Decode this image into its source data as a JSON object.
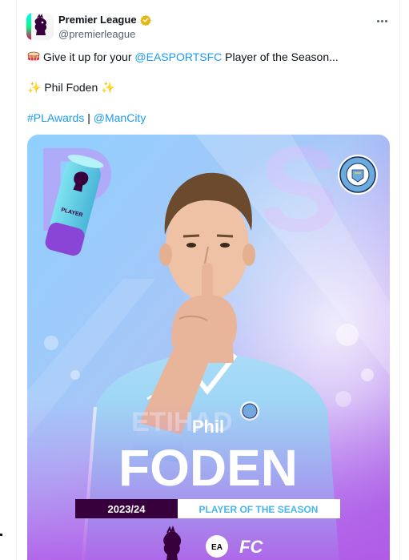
{
  "account": {
    "name": "Premier League",
    "handle": "@premierleague",
    "verified": true
  },
  "icons": {
    "avatar": "premier-league-lion-logo",
    "verified": "verified-badge-gold",
    "more": "more-horizontal-icon",
    "drum": "drum-emoji",
    "sparkles": "sparkles-emoji"
  },
  "tweet": {
    "line1_before": "Give it up for your ",
    "line1_mention": "@EASPORTSFC",
    "line1_after": " Player of the Season...",
    "line2": "Phil Foden",
    "hashtag": "#PLAwards",
    "separator": " | ",
    "mention2": "@ManCity"
  },
  "graphic": {
    "first_name": "Phil",
    "last_name": "FODEN",
    "season": "2023/24",
    "award": "PLAYER OF THE SEASON",
    "trophy_text": "PLAYER",
    "club_badge_text": "MANCHESTER CITY",
    "sponsor": "EA SPORTS"
  },
  "colors": {
    "link": "#1d9bf0",
    "verified": "#e2b719",
    "text": "#0f1419",
    "muted": "#536471",
    "graphic_sky": "#9fd3f5",
    "graphic_purple": "#8a3bd6",
    "banner_dark": "#37003c"
  }
}
